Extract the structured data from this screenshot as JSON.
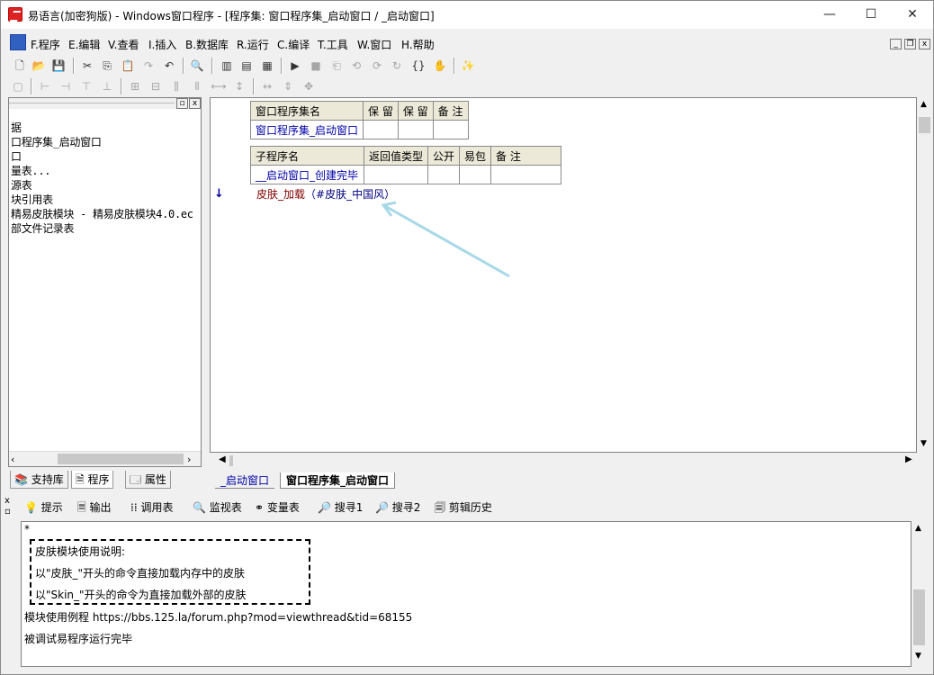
{
  "title": "易语言(加密狗版) - Windows窗口程序 - [程序集: 窗口程序集_启动窗口 / _启动窗口]",
  "window_controls": {
    "minimize": "—",
    "maximize": "☐",
    "close": "✕"
  },
  "menu": [
    "F.程序",
    "E.编辑",
    "V.查看",
    "I.插入",
    "B.数据库",
    "R.运行",
    "C.编译",
    "T.工具",
    "W.窗口",
    "H.帮助"
  ],
  "mdi_controls": {
    "minimize": "_",
    "restore": "❐",
    "close": "x"
  },
  "left_tree": [
    "数据",
    "窗口程序集_启动窗口",
    "窗口",
    "常量表...",
    "资源表",
    "模块引用表",
    "  精易皮肤模块 - 精易皮肤模块4.0.ec",
    "外部文件记录表"
  ],
  "left_tree_visible": [
    "据",
    "口程序集_启动窗口",
    "口",
    "量表...",
    "源表",
    "块引用表",
    " 精易皮肤模块 - 精易皮肤模块4.0.ec",
    "部文件记录表"
  ],
  "left_tabs": [
    "支持库",
    "程序",
    "属性"
  ],
  "assembly_table": {
    "headers": [
      "窗口程序集名",
      "保 留",
      "保 留",
      "备 注"
    ],
    "row": [
      "窗口程序集_启动窗口",
      "",
      "",
      ""
    ]
  },
  "sub_table": {
    "headers": [
      "子程序名",
      "返回值类型",
      "公开",
      "易包",
      "备 注"
    ],
    "row": [
      "__启动窗口_创建完毕",
      "",
      "",
      "",
      ""
    ]
  },
  "code": {
    "command": "皮肤_加载",
    "args": "（#皮肤_中国风）",
    "marker": "↓"
  },
  "editor_tabs": [
    "_启动窗口",
    "窗口程序集_启动窗口"
  ],
  "bottom_tabs": [
    "提示",
    "输出",
    "调用表",
    "监视表",
    "变量表",
    "搜寻1",
    "搜寻2",
    "剪辑历史"
  ],
  "output": {
    "star": "*",
    "box_lines": [
      "皮肤模块使用说明:",
      "以\"皮肤_\"开头的命令直接加载内存中的皮肤",
      "以\"Skin_\"开头的命令为直接加载外部的皮肤"
    ],
    "line1": "模块使用例程 https://bbs.125.la/forum.php?mod=viewthread&tid=68155",
    "line2": "被调试易程序运行完毕"
  },
  "colors": {
    "annotation_arrow": "#a8d8e8",
    "link_text": "#0000a8",
    "command_text": "#800000"
  }
}
